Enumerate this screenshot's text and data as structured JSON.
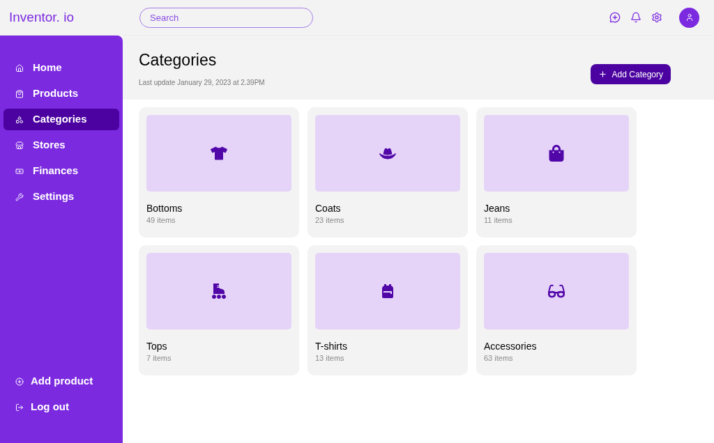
{
  "brand": "Inventor. io",
  "search": {
    "placeholder": "Search"
  },
  "sidebar": {
    "items": [
      {
        "label": "Home",
        "selected": false
      },
      {
        "label": "Products",
        "selected": false
      },
      {
        "label": "Categories",
        "selected": true
      },
      {
        "label": "Stores",
        "selected": false
      },
      {
        "label": "Finances",
        "selected": false
      },
      {
        "label": "Settings",
        "selected": false
      }
    ],
    "bottom_items": [
      {
        "label": "Add product"
      },
      {
        "label": "Log out"
      }
    ]
  },
  "page": {
    "title": "Categories",
    "subtitle": "Last update January 29, 2023 at 2.39PM",
    "action": "Add Category"
  },
  "categories": [
    {
      "name": "Bottoms",
      "count": "49 items"
    },
    {
      "name": "Coats",
      "count": "23 items"
    },
    {
      "name": "Jeans",
      "count": "11 items"
    },
    {
      "name": "Tops",
      "count": "7 items"
    },
    {
      "name": "T-shirts",
      "count": "13 items"
    },
    {
      "name": "Accessories",
      "count": "63 items"
    }
  ]
}
